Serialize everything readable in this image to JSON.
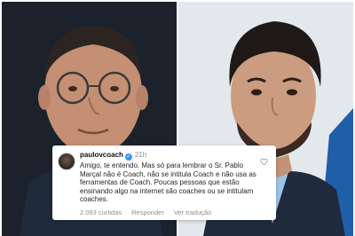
{
  "comment": {
    "username": "paulovcoach",
    "age": "21h",
    "text": "Amigo, te entendo. Mas só para lembrar o Sr. Pablo Marçal não é Coach, não se intitula Coach e não usa as ferramentas de Coach. Poucas pessoas que estão ensinando algo na internet são coaches ou se intitulam coaches.",
    "likes": "2.093 curtidas",
    "reply_label": "Responder",
    "translate_label": "Ver tradução"
  },
  "colors": {
    "verified": "#3897f0",
    "muted_text": "#8e8e8e",
    "body_text": "#262626"
  }
}
